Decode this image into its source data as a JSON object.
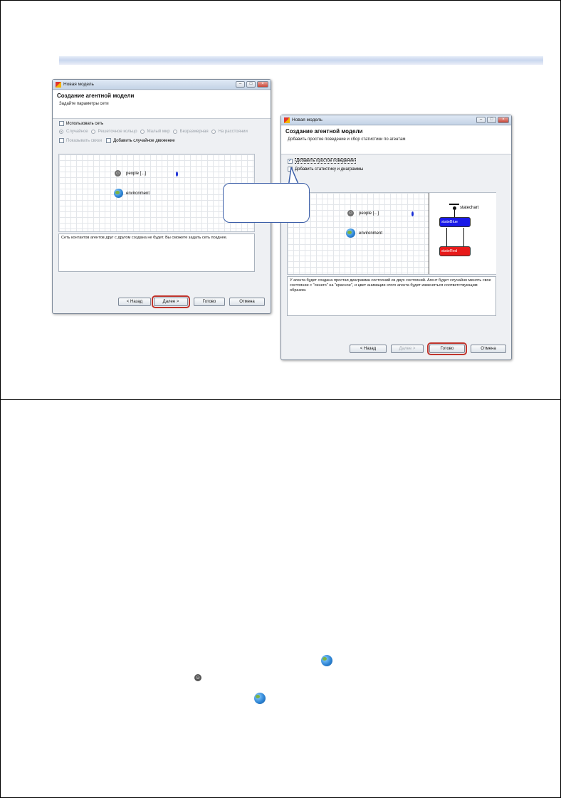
{
  "dialog1": {
    "window_title": "Новая модель",
    "wizard_title": "Создание агентной модели",
    "wizard_subtitle": "Задайте параметры сети",
    "use_network_label": "Использовать сеть",
    "network_types": [
      "Случайное",
      "Решеточное кольцо",
      "Малый мир",
      "Безразмерная",
      "На расстоянии"
    ],
    "selected_network_type": "Случайное",
    "show_links_label": "Показывать связи",
    "random_movement_label": "Добавить случайное движение",
    "canvas": {
      "people_label": "people [...]",
      "environment_label": "environment"
    },
    "description": "Сеть контактов агентов друг с другом создана не будет. Вы сможете задать сеть позднее.",
    "buttons": {
      "back": "< Назад",
      "next": "Далее >",
      "finish": "Готово",
      "cancel": "Отмена"
    }
  },
  "dialog2": {
    "window_title": "Новая модель",
    "wizard_title": "Создание агентной модели",
    "wizard_subtitle": "Добавить простое поведение и сбор статистики по агентам",
    "simple_behavior_label": "Добавить простое поведение",
    "simple_behavior_checked": true,
    "statistics_label": "Добавить статистику и диаграммы",
    "statistics_checked": false,
    "canvas": {
      "people_label": "people [...]",
      "environment_label": "environment",
      "statechart_label": "statechart",
      "state_blue_label": "stateBlue",
      "state_red_label": "stateRed"
    },
    "description": "У агента будет создана простая диаграмма состояний из двух состояний. Агент будет случайно менять свое состояние с \"синего\" на \"красное\", и цвет анимации этого агента будет изменяться соответствующим образом.",
    "buttons": {
      "back": "< Назад",
      "next": "Далее >",
      "finish": "Готово",
      "cancel": "Отмена"
    }
  },
  "colors": {
    "highlight": "#c0342c",
    "callout_border": "#3c5fa8",
    "state_blue": "#1a1ae8",
    "state_red": "#e81a1a"
  },
  "icons": [
    "app-icon",
    "person-icon",
    "globe-icon"
  ]
}
